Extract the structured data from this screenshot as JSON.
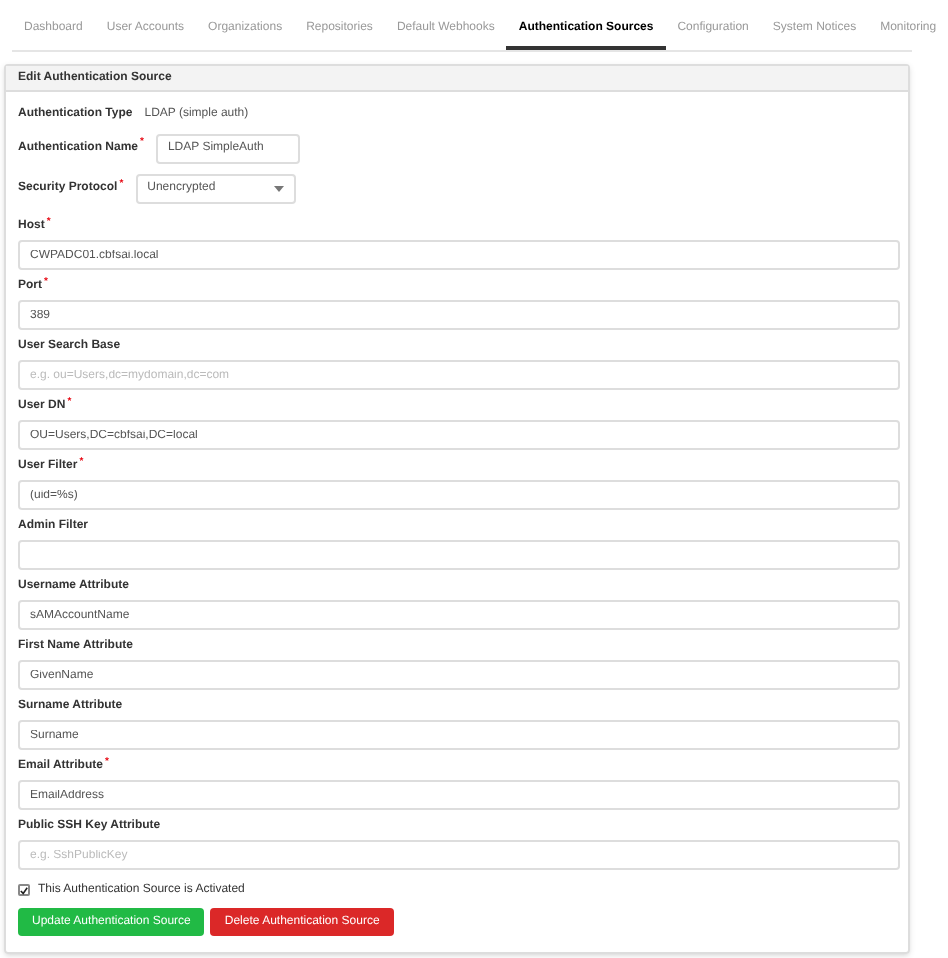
{
  "tabs": [
    {
      "label": "Dashboard",
      "selected": false
    },
    {
      "label": "User Accounts",
      "selected": false
    },
    {
      "label": "Organizations",
      "selected": false
    },
    {
      "label": "Repositories",
      "selected": false
    },
    {
      "label": "Default Webhooks",
      "selected": false
    },
    {
      "label": "Authentication Sources",
      "selected": true
    },
    {
      "label": "Configuration",
      "selected": false
    },
    {
      "label": "System Notices",
      "selected": false
    },
    {
      "label": "Monitoring",
      "selected": false
    }
  ],
  "required_mark": "*",
  "panel": {
    "title": "Edit Authentication Source",
    "auth_type": {
      "label": "Authentication Type",
      "value": "LDAP (simple auth)"
    },
    "auth_name": {
      "label": "Authentication Name",
      "required": true,
      "value": "LDAP SimpleAuth"
    },
    "security_protocol": {
      "label": "Security Protocol",
      "required": true,
      "value": "Unencrypted"
    },
    "fields": [
      {
        "label": "Host",
        "required": true,
        "value": "CWPADC01.cbfsai.local"
      },
      {
        "label": "Port",
        "required": true,
        "value": "389"
      },
      {
        "label": "User Search Base",
        "required": false,
        "placeholder": "e.g. ou=Users,dc=mydomain,dc=com"
      },
      {
        "label": "User DN",
        "required": true,
        "value": "OU=Users,DC=cbfsai,DC=local"
      },
      {
        "label": "User Filter",
        "required": true,
        "value": "(uid=%s)"
      },
      {
        "label": "Admin Filter",
        "required": false
      },
      {
        "label": "Username Attribute",
        "required": false,
        "value": "sAMAccountName"
      },
      {
        "label": "First Name Attribute",
        "required": false,
        "value": "GivenName"
      },
      {
        "label": "Surname Attribute",
        "required": false,
        "value": "Surname"
      },
      {
        "label": "Email Attribute",
        "required": true,
        "value": "EmailAddress"
      },
      {
        "label": "Public SSH Key Attribute",
        "required": false,
        "placeholder": "e.g. SshPublicKey"
      }
    ],
    "activated": {
      "label": "This Authentication Source is Activated",
      "checked": true
    },
    "buttons": [
      {
        "label": "Update Authentication Source",
        "kind": "update"
      },
      {
        "label": "Delete Authentication Source",
        "kind": "delete"
      }
    ]
  }
}
